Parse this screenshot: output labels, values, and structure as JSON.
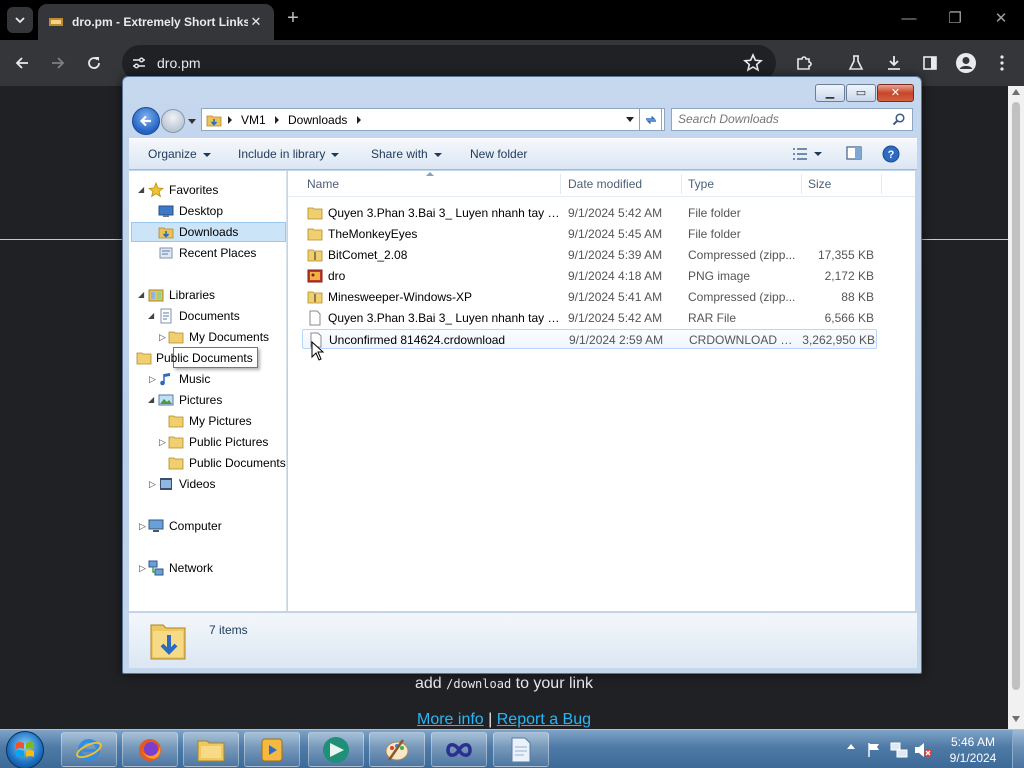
{
  "browser": {
    "tab_title": "dro.pm - Extremely Short Links",
    "tab_close": "✕",
    "new_tab": "+",
    "url": "dro.pm",
    "minimize": "—",
    "restore": "❐",
    "close": "✕"
  },
  "webpage": {
    "hint_prefix": "add ",
    "hint_code": "/download",
    "hint_suffix": " to your link",
    "more_info": "More info",
    "separator": " | ",
    "report_bug": "Report a Bug"
  },
  "explorer": {
    "breadcrumbs": [
      "VM1",
      "Downloads"
    ],
    "search_placeholder": "Search Downloads",
    "commands": {
      "organize": "Organize",
      "include_in_library": "Include in library",
      "share_with": "Share with",
      "new_folder": "New folder"
    },
    "nav": {
      "favorites": "Favorites",
      "desktop": "Desktop",
      "downloads": "Downloads",
      "recent_places": "Recent Places",
      "libraries": "Libraries",
      "documents": "Documents",
      "my_documents": "My Documents",
      "public_documents": "Public Documents",
      "music": "Music",
      "pictures": "Pictures",
      "my_pictures": "My Pictures",
      "public_pictures": "Public Pictures",
      "public_documents_2": "Public Documents",
      "videos": "Videos",
      "computer": "Computer",
      "network": "Network"
    },
    "tooltip": "Public Documents",
    "columns": {
      "name": "Name",
      "date_modified": "Date modified",
      "type": "Type",
      "size": "Size"
    },
    "files": [
      {
        "name": "Quyen 3.Phan 3.Bai 3_ Luyen nhanh tay ti...",
        "date": "9/1/2024 5:42 AM",
        "type": "File folder",
        "size": "",
        "icon": "folder-icon"
      },
      {
        "name": "TheMonkeyEyes",
        "date": "9/1/2024 5:45 AM",
        "type": "File folder",
        "size": "",
        "icon": "folder-icon"
      },
      {
        "name": "BitComet_2.08",
        "date": "9/1/2024 5:39 AM",
        "type": "Compressed (zipp...",
        "size": "17,355 KB",
        "icon": "zip-folder-icon"
      },
      {
        "name": "dro",
        "date": "9/1/2024 4:18 AM",
        "type": "PNG image",
        "size": "2,172 KB",
        "icon": "image-file-icon"
      },
      {
        "name": "Minesweeper-Windows-XP",
        "date": "9/1/2024 5:41 AM",
        "type": "Compressed (zipp...",
        "size": "88 KB",
        "icon": "zip-folder-icon"
      },
      {
        "name": "Quyen 3.Phan 3.Bai 3_ Luyen nhanh tay ti...",
        "date": "9/1/2024 5:42 AM",
        "type": "RAR File",
        "size": "6,566 KB",
        "icon": "blank-file-icon"
      },
      {
        "name": "Unconfirmed 814624.crdownload",
        "date": "9/1/2024 2:59 AM",
        "type": "CRDOWNLOAD File",
        "size": "3,262,950 KB",
        "icon": "blank-file-icon"
      }
    ],
    "status_count": "7 items"
  },
  "taskbar": {
    "time": "5:46 AM",
    "date": "9/1/2024"
  },
  "colors": {
    "chrome_dark": "#202124",
    "chrome_toolbar": "#35363a",
    "link": "#29b6f6",
    "selection": "#cce4f7"
  }
}
